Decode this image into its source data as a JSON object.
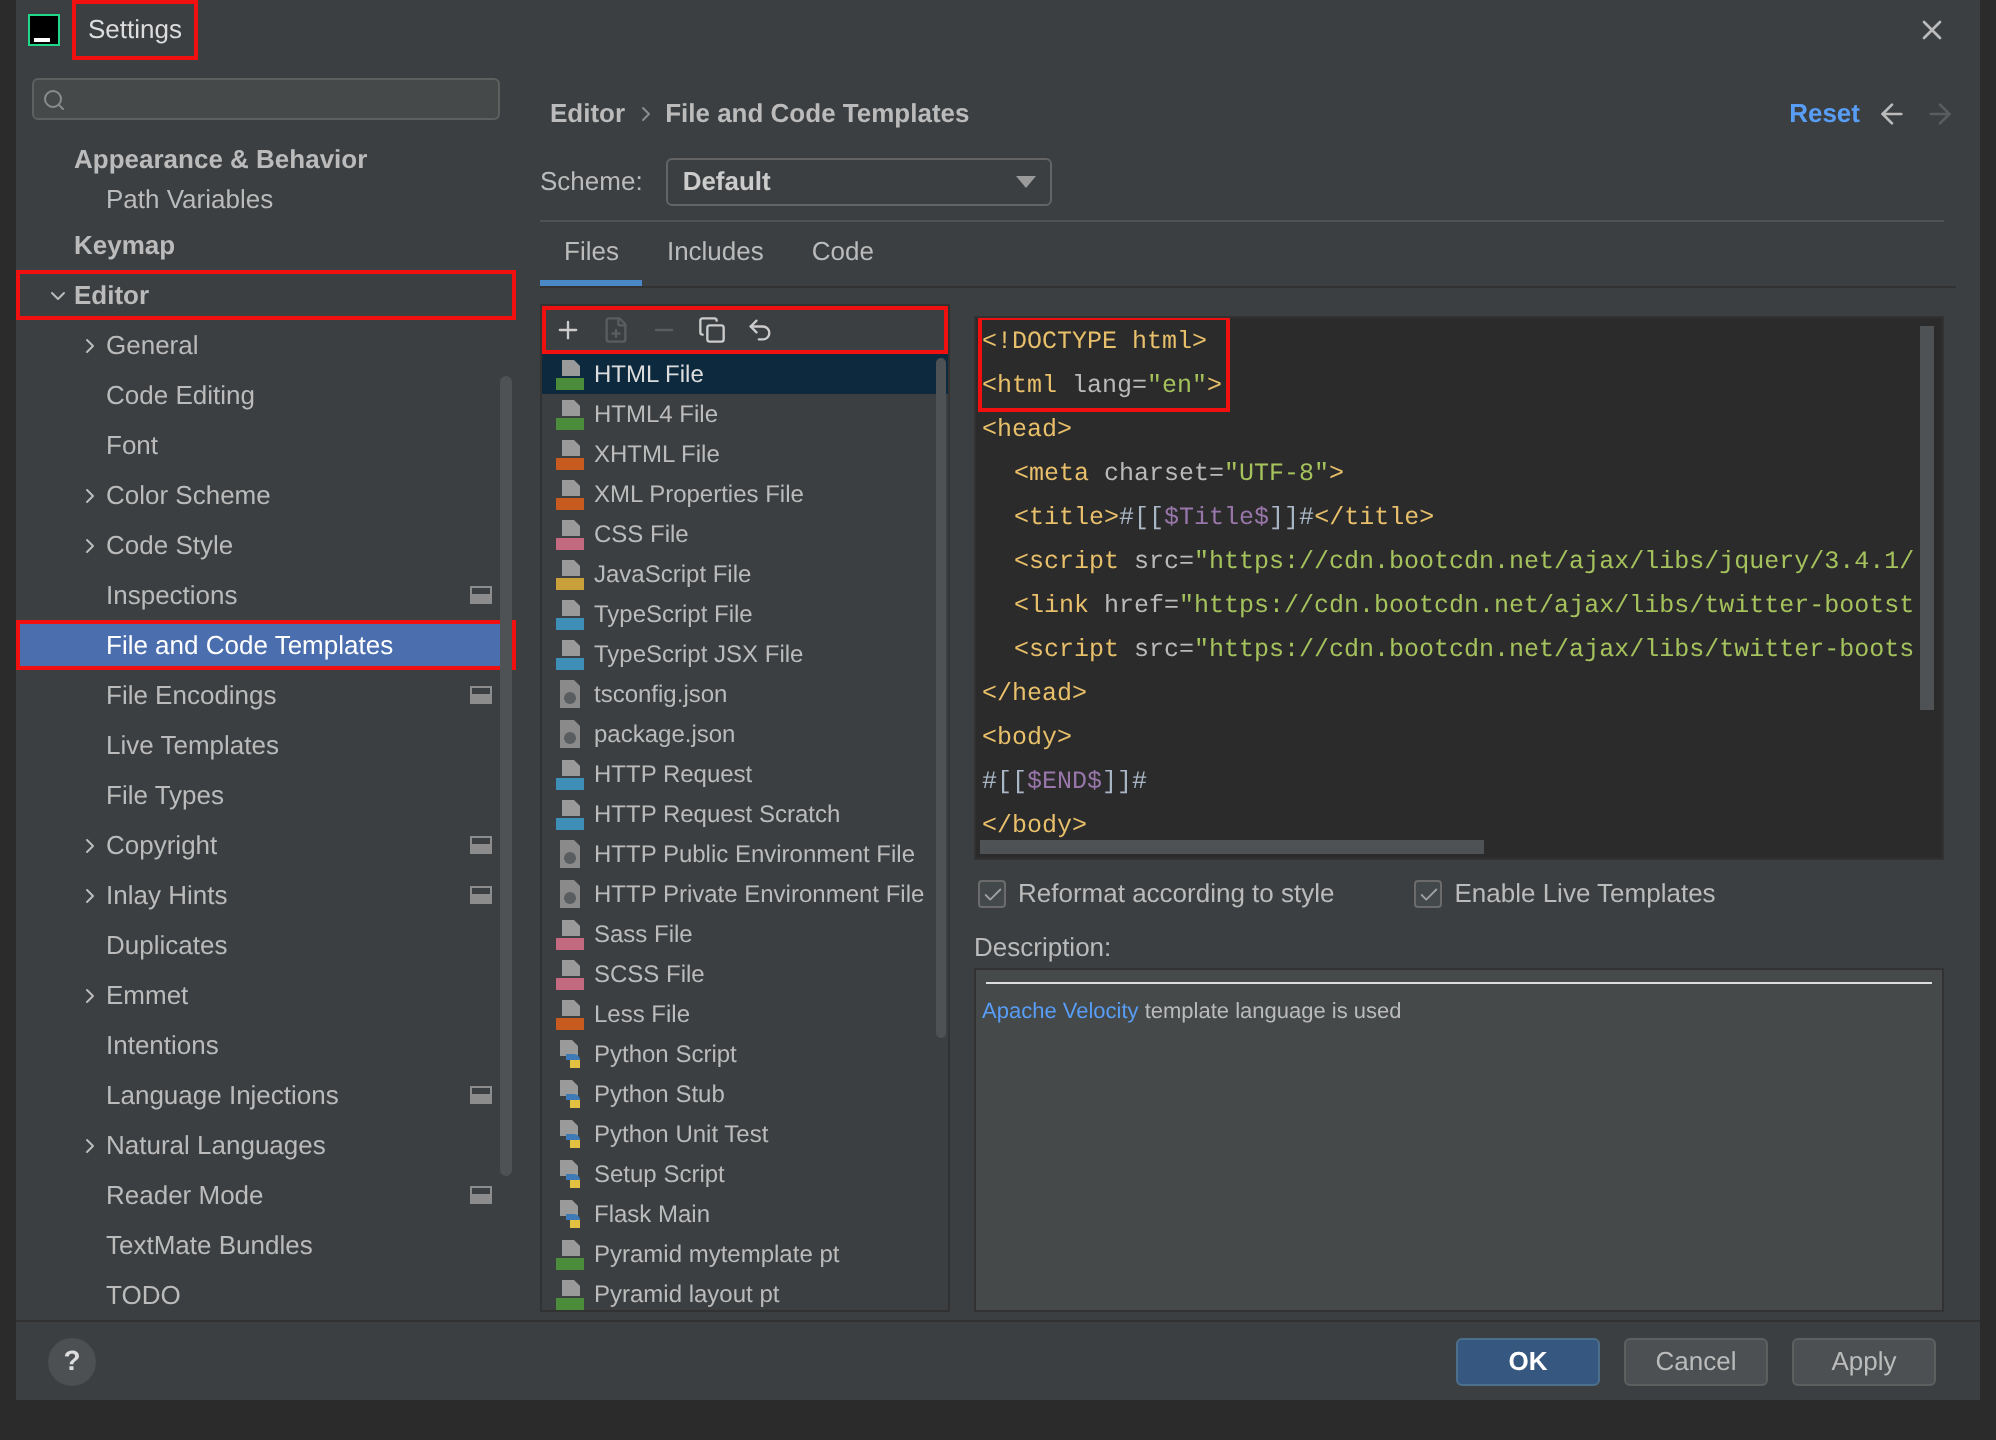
{
  "window": {
    "title": "Settings",
    "highlighted": true
  },
  "sidebar": {
    "items": [
      {
        "label": "Appearance & Behavior",
        "expandable": false,
        "selected": false,
        "project_level": false,
        "highlighted": false,
        "children": [
          {
            "label": "Path Variables",
            "expandable": false,
            "selected": false,
            "project_level": false,
            "highlighted": false
          }
        ]
      },
      {
        "label": "Keymap",
        "expandable": false,
        "selected": false,
        "project_level": false,
        "highlighted": false
      },
      {
        "label": "Editor",
        "expandable": true,
        "expanded": true,
        "selected": false,
        "project_level": false,
        "highlighted": true,
        "children": [
          {
            "label": "General",
            "expandable": true,
            "expanded": false,
            "selected": false,
            "project_level": false,
            "highlighted": false
          },
          {
            "label": "Code Editing",
            "expandable": false,
            "selected": false,
            "project_level": false,
            "highlighted": false
          },
          {
            "label": "Font",
            "expandable": false,
            "selected": false,
            "project_level": false,
            "highlighted": false
          },
          {
            "label": "Color Scheme",
            "expandable": true,
            "expanded": false,
            "selected": false,
            "project_level": false,
            "highlighted": false
          },
          {
            "label": "Code Style",
            "expandable": true,
            "expanded": false,
            "selected": false,
            "project_level": false,
            "highlighted": false
          },
          {
            "label": "Inspections",
            "expandable": false,
            "selected": false,
            "project_level": true,
            "highlighted": false
          },
          {
            "label": "File and Code Templates",
            "expandable": false,
            "selected": true,
            "project_level": false,
            "highlighted": true
          },
          {
            "label": "File Encodings",
            "expandable": false,
            "selected": false,
            "project_level": true,
            "highlighted": false
          },
          {
            "label": "Live Templates",
            "expandable": false,
            "selected": false,
            "project_level": false,
            "highlighted": false
          },
          {
            "label": "File Types",
            "expandable": false,
            "selected": false,
            "project_level": false,
            "highlighted": false
          },
          {
            "label": "Copyright",
            "expandable": true,
            "expanded": false,
            "selected": false,
            "project_level": true,
            "highlighted": false
          },
          {
            "label": "Inlay Hints",
            "expandable": true,
            "expanded": false,
            "selected": false,
            "project_level": true,
            "highlighted": false
          },
          {
            "label": "Duplicates",
            "expandable": false,
            "selected": false,
            "project_level": false,
            "highlighted": false
          },
          {
            "label": "Emmet",
            "expandable": true,
            "expanded": false,
            "selected": false,
            "project_level": false,
            "highlighted": false
          },
          {
            "label": "Intentions",
            "expandable": false,
            "selected": false,
            "project_level": false,
            "highlighted": false
          },
          {
            "label": "Language Injections",
            "expandable": false,
            "selected": false,
            "project_level": true,
            "highlighted": false
          },
          {
            "label": "Natural Languages",
            "expandable": true,
            "expanded": false,
            "selected": false,
            "project_level": false,
            "highlighted": false
          },
          {
            "label": "Reader Mode",
            "expandable": false,
            "selected": false,
            "project_level": true,
            "highlighted": false
          },
          {
            "label": "TextMate Bundles",
            "expandable": false,
            "selected": false,
            "project_level": false,
            "highlighted": false
          },
          {
            "label": "TODO",
            "expandable": false,
            "selected": false,
            "project_level": false,
            "highlighted": false
          }
        ]
      }
    ]
  },
  "breadcrumb": [
    "Editor",
    "File and Code Templates"
  ],
  "reset": "Reset",
  "nav": [
    {
      "kind": "back",
      "disabled": false
    },
    {
      "kind": "forward",
      "disabled": true
    }
  ],
  "scheme": {
    "label": "Scheme:",
    "value": "Default"
  },
  "tabs": [
    {
      "label": "Files",
      "selected": true
    },
    {
      "label": "Includes",
      "selected": false
    },
    {
      "label": "Code",
      "selected": false
    }
  ],
  "toolbar": [
    {
      "kind": "add",
      "disabled": false
    },
    {
      "kind": "add-child",
      "disabled": true
    },
    {
      "kind": "remove",
      "disabled": true
    },
    {
      "kind": "copy",
      "disabled": false
    },
    {
      "kind": "reset",
      "disabled": false
    }
  ],
  "toolbar_highlighted": true,
  "templates": [
    {
      "label": "HTML File",
      "kind": "html",
      "selected": true
    },
    {
      "label": "HTML4 File",
      "kind": "html",
      "selected": false
    },
    {
      "label": "XHTML File",
      "kind": "xhtml",
      "selected": false
    },
    {
      "label": "XML Properties File",
      "kind": "xml",
      "selected": false
    },
    {
      "label": "CSS File",
      "kind": "css",
      "selected": false
    },
    {
      "label": "JavaScript File",
      "kind": "js",
      "selected": false
    },
    {
      "label": "TypeScript File",
      "kind": "ts",
      "selected": false
    },
    {
      "label": "TypeScript JSX File",
      "kind": "ts",
      "selected": false
    },
    {
      "label": "tsconfig.json",
      "kind": "json",
      "selected": false
    },
    {
      "label": "package.json",
      "kind": "json",
      "selected": false
    },
    {
      "label": "HTTP Request",
      "kind": "api",
      "selected": false
    },
    {
      "label": "HTTP Request Scratch",
      "kind": "api",
      "selected": false
    },
    {
      "label": "HTTP Public Environment File",
      "kind": "json",
      "selected": false
    },
    {
      "label": "HTTP Private Environment File",
      "kind": "json",
      "selected": false
    },
    {
      "label": "Sass File",
      "kind": "sass",
      "selected": false
    },
    {
      "label": "SCSS File",
      "kind": "sass",
      "selected": false
    },
    {
      "label": "Less File",
      "kind": "less",
      "selected": false
    },
    {
      "label": "Python Script",
      "kind": "python",
      "selected": false
    },
    {
      "label": "Python Stub",
      "kind": "python",
      "selected": false
    },
    {
      "label": "Python Unit Test",
      "kind": "python",
      "selected": false
    },
    {
      "label": "Setup Script",
      "kind": "python",
      "selected": false
    },
    {
      "label": "Flask Main",
      "kind": "python",
      "selected": false
    },
    {
      "label": "Pyramid mytemplate pt",
      "kind": "pyramid",
      "selected": false
    },
    {
      "label": "Pyramid layout pt",
      "kind": "pyramid",
      "selected": false
    }
  ],
  "code": [
    {
      "indent": false,
      "highlighted": true,
      "parts": [
        {
          "kind": "tag",
          "text": "<!DOCTYPE html>"
        }
      ]
    },
    {
      "indent": false,
      "highlighted": true,
      "parts": [
        {
          "kind": "tag",
          "text": "<html"
        },
        {
          "kind": "attr",
          "text": " lang="
        },
        {
          "kind": "string",
          "text": "\"en\""
        },
        {
          "kind": "tag",
          "text": ">"
        }
      ]
    },
    {
      "indent": false,
      "highlighted": false,
      "parts": [
        {
          "kind": "tag",
          "text": "<head>"
        }
      ]
    },
    {
      "indent": true,
      "highlighted": false,
      "parts": [
        {
          "kind": "tag",
          "text": "<meta"
        },
        {
          "kind": "attr",
          "text": " charset="
        },
        {
          "kind": "string",
          "text": "\"UTF-8\""
        },
        {
          "kind": "tag",
          "text": ">"
        }
      ]
    },
    {
      "indent": true,
      "highlighted": false,
      "parts": [
        {
          "kind": "tag",
          "text": "<title>"
        },
        {
          "kind": "text",
          "text": "#[["
        },
        {
          "kind": "var",
          "text": "$Title$"
        },
        {
          "kind": "text",
          "text": "]]#"
        },
        {
          "kind": "tag",
          "text": "</title>"
        }
      ]
    },
    {
      "indent": true,
      "highlighted": false,
      "parts": [
        {
          "kind": "tag",
          "text": "<script"
        },
        {
          "kind": "attr",
          "text": " src="
        },
        {
          "kind": "string",
          "text": "\"https://cdn.bootcdn.net/ajax/libs/jquery/3.4.1/"
        }
      ]
    },
    {
      "indent": true,
      "highlighted": false,
      "parts": [
        {
          "kind": "tag",
          "text": "<link"
        },
        {
          "kind": "attr",
          "text": " href="
        },
        {
          "kind": "string",
          "text": "\"https://cdn.bootcdn.net/ajax/libs/twitter-bootst"
        }
      ]
    },
    {
      "indent": true,
      "highlighted": false,
      "parts": [
        {
          "kind": "tag",
          "text": "<script"
        },
        {
          "kind": "attr",
          "text": " src="
        },
        {
          "kind": "string",
          "text": "\"https://cdn.bootcdn.net/ajax/libs/twitter-boots"
        }
      ]
    },
    {
      "indent": false,
      "highlighted": false,
      "parts": [
        {
          "kind": "tag",
          "text": "</head>"
        }
      ]
    },
    {
      "indent": false,
      "highlighted": false,
      "parts": [
        {
          "kind": "tag",
          "text": "<body>"
        }
      ]
    },
    {
      "indent": false,
      "highlighted": false,
      "parts": [
        {
          "kind": "text",
          "text": "#[["
        },
        {
          "kind": "var",
          "text": "$END$"
        },
        {
          "kind": "text",
          "text": "]]#"
        }
      ]
    },
    {
      "indent": false,
      "highlighted": false,
      "parts": [
        {
          "kind": "tag",
          "text": "</body>"
        }
      ]
    }
  ],
  "options": [
    {
      "label": "Reformat according to style",
      "checked": true
    },
    {
      "label": "Enable Live Templates",
      "checked": true
    }
  ],
  "description": {
    "label": "Description:",
    "link": "Apache Velocity",
    "text": "template language is used"
  },
  "help": "?",
  "buttons": [
    {
      "label": "OK",
      "kind": "primary"
    },
    {
      "label": "Cancel",
      "kind": "normal"
    },
    {
      "label": "Apply",
      "kind": "normal"
    }
  ]
}
